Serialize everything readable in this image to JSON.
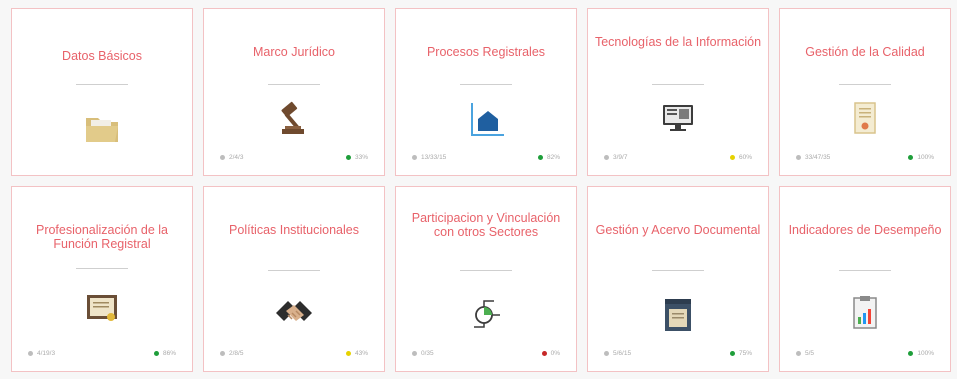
{
  "cards": [
    {
      "title": "Datos Básicos",
      "icon": "folder-icon",
      "count": "",
      "percent": "",
      "status_color": ""
    },
    {
      "title": "Marco Jurídico",
      "icon": "gavel-icon",
      "count": "2/4/3",
      "percent": "33%",
      "status_color": "#1e9e3a"
    },
    {
      "title": "Procesos Registrales",
      "icon": "house-chart-icon",
      "count": "13/33/15",
      "percent": "82%",
      "status_color": "#1e9e3a"
    },
    {
      "title": "Tecnologías de la Información",
      "icon": "monitor-icon",
      "count": "3/9/7",
      "percent": "60%",
      "status_color": "#e6d200"
    },
    {
      "title": "Gestión de la Calidad",
      "icon": "certificate-icon",
      "count": "33/47/35",
      "percent": "100%",
      "status_color": "#1e9e3a"
    },
    {
      "title": "Profesionalización de la Función Registral",
      "icon": "diploma-icon",
      "count": "4/19/3",
      "percent": "86%",
      "status_color": "#1e9e3a"
    },
    {
      "title": "Políticas Institucionales",
      "icon": "handshake-icon",
      "count": "2/8/5",
      "percent": "43%",
      "status_color": "#e6d200"
    },
    {
      "title": "Participacion y Vinculación con otros Sectores",
      "icon": "network-icon",
      "count": "0/35",
      "percent": "0%",
      "status_color": "#c62828"
    },
    {
      "title": "Gestión y Acervo Documental",
      "icon": "file-cabinet-icon",
      "count": "5/6/15",
      "percent": "75%",
      "status_color": "#1e9e3a"
    },
    {
      "title": "Indicadores de Desempeño",
      "icon": "clipboard-chart-icon",
      "count": "5/5",
      "percent": "100%",
      "status_color": "#1e9e3a"
    }
  ]
}
